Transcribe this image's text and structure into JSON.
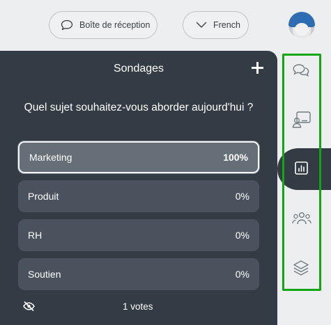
{
  "header": {
    "inbox_label": "Boîte de réception",
    "language_label": "French"
  },
  "avatar": {
    "icon": "user-avatar"
  },
  "panel": {
    "title": "Sondages",
    "add_icon": "plus-icon"
  },
  "poll": {
    "question": "Quel sujet souhaitez-vous aborder aujourd'hui ?",
    "options": [
      {
        "label": "Marketing",
        "percent": "100%",
        "selected": true
      },
      {
        "label": "Produit",
        "percent": "0%",
        "selected": false
      },
      {
        "label": "RH",
        "percent": "0%",
        "selected": false
      },
      {
        "label": "Soutien",
        "percent": "0%",
        "selected": false
      }
    ],
    "votes": "1 votes",
    "hide_icon": "eye-off-icon"
  },
  "rail": {
    "items": [
      {
        "icon": "chat-icon",
        "active": false
      },
      {
        "icon": "presenter-icon",
        "active": false
      },
      {
        "icon": "poll-chart-icon",
        "active": true
      },
      {
        "icon": "users-icon",
        "active": false
      },
      {
        "icon": "layers-icon",
        "active": false
      }
    ]
  },
  "colors": {
    "panel_bg": "#333b44",
    "option_bg": "#4a535d",
    "selected_option_bg": "#666e77",
    "highlight_outline": "#12a612",
    "page_bg": "#eceeef"
  }
}
